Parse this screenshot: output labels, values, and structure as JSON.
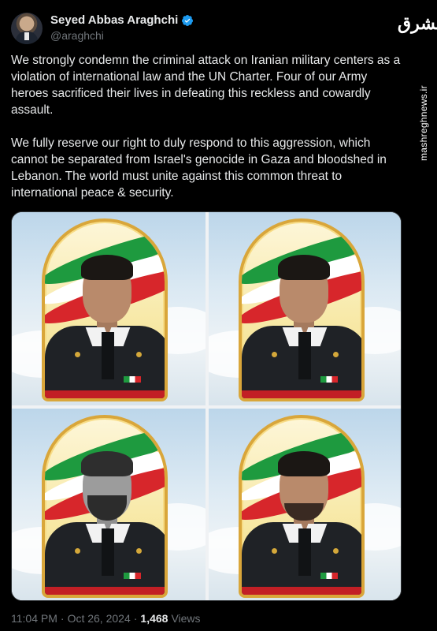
{
  "author": {
    "name": "Seyed Abbas Araghchi",
    "handle": "@araghchi",
    "verified": true
  },
  "watermark": {
    "logo_text": "مشرق",
    "site": "mashreghnews.ir"
  },
  "tweet": {
    "paragraphs": [
      "We strongly condemn the criminal attack on Iranian military centers as a violation of international law and the UN Charter. Four of our Army heroes sacrificed their lives in defeating this reckless and cowardly assault.",
      "We fully reserve our right to duly respond to this aggression, which cannot be separated from Israel's genocide in Gaza and bloodshed in Lebanon. The world must unite against this common threat to international peace & security."
    ]
  },
  "meta": {
    "time": "11:04 PM",
    "separator": "·",
    "date": "Oct 26, 2024",
    "views_count": "1,468",
    "views_label": "Views"
  },
  "colors": {
    "background": "#000000",
    "text": "#e7e9ea",
    "muted": "#71767b",
    "verified_badge": "#1d9bf0"
  }
}
